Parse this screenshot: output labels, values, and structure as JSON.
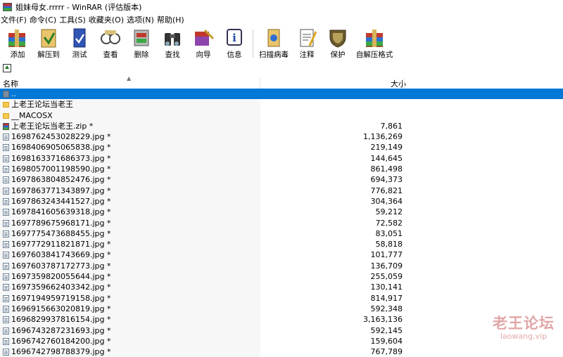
{
  "window": {
    "title": "姐妹母女.rrrrr - WinRAR (评估版本)"
  },
  "menu": [
    "文件(F)",
    "命令(C)",
    "工具(S)",
    "收藏夹(O)",
    "选项(N)",
    "帮助(H)"
  ],
  "toolbar": [
    {
      "label": "添加",
      "icon": "add-archive-icon"
    },
    {
      "label": "解压到",
      "icon": "extract-to-icon"
    },
    {
      "label": "测试",
      "icon": "test-icon"
    },
    {
      "label": "查看",
      "icon": "view-icon"
    },
    {
      "label": "删除",
      "icon": "delete-icon"
    },
    {
      "label": "查找",
      "icon": "find-icon"
    },
    {
      "label": "向导",
      "icon": "wizard-icon"
    },
    {
      "label": "信息",
      "icon": "info-icon"
    },
    {
      "label": "扫描病毒",
      "icon": "virus-scan-icon"
    },
    {
      "label": "注释",
      "icon": "comment-icon"
    },
    {
      "label": "保护",
      "icon": "protect-icon"
    },
    {
      "label": "自解压格式",
      "icon": "sfx-icon"
    }
  ],
  "columns": {
    "name": "名称",
    "size": "大小"
  },
  "rows": [
    {
      "name": "..",
      "size": "",
      "type": "updir"
    },
    {
      "name": "上老王论坛当老王",
      "size": "",
      "type": "folder"
    },
    {
      "name": "__MACOSX",
      "size": "",
      "type": "folder"
    },
    {
      "name": "上老王论坛当老王.zip *",
      "size": "7,861",
      "type": "zip"
    },
    {
      "name": "1698762453028229.jpg *",
      "size": "1,136,269",
      "type": "file"
    },
    {
      "name": "1698406905065838.jpg *",
      "size": "219,149",
      "type": "file"
    },
    {
      "name": "1698163371686373.jpg *",
      "size": "144,645",
      "type": "file"
    },
    {
      "name": "1698057001198590.jpg *",
      "size": "861,498",
      "type": "file"
    },
    {
      "name": "1697863804852476.jpg *",
      "size": "694,373",
      "type": "file"
    },
    {
      "name": "1697863771343897.jpg *",
      "size": "776,821",
      "type": "file"
    },
    {
      "name": "1697863243441527.jpg *",
      "size": "304,364",
      "type": "file"
    },
    {
      "name": "1697841605639318.jpg *",
      "size": "59,212",
      "type": "file"
    },
    {
      "name": "1697789675968171.jpg *",
      "size": "72,582",
      "type": "file"
    },
    {
      "name": "1697775473688455.jpg *",
      "size": "83,051",
      "type": "file"
    },
    {
      "name": "1697772911821871.jpg *",
      "size": "58,818",
      "type": "file"
    },
    {
      "name": "1697603841743669.jpg *",
      "size": "101,777",
      "type": "file"
    },
    {
      "name": "1697603787172773.jpg *",
      "size": "136,709",
      "type": "file"
    },
    {
      "name": "1697359820055644.jpg *",
      "size": "255,059",
      "type": "file"
    },
    {
      "name": "1697359662403342.jpg *",
      "size": "130,141",
      "type": "file"
    },
    {
      "name": "1697194959719158.jpg *",
      "size": "814,917",
      "type": "file"
    },
    {
      "name": "1696915663020819.jpg *",
      "size": "592,348",
      "type": "file"
    },
    {
      "name": "1696829937816154.jpg *",
      "size": "3,163,136",
      "type": "file"
    },
    {
      "name": "1696743287231693.jpg *",
      "size": "592,145",
      "type": "file"
    },
    {
      "name": "1696742760184200.jpg *",
      "size": "159,604",
      "type": "file"
    },
    {
      "name": "1696742798788379.jpg *",
      "size": "767,789",
      "type": "file"
    }
  ],
  "watermark": {
    "text": "老王论坛",
    "url": "laowang.vip"
  },
  "colors": {
    "selection": "#0078d7",
    "name_column_bg": "#f7f7f7"
  }
}
